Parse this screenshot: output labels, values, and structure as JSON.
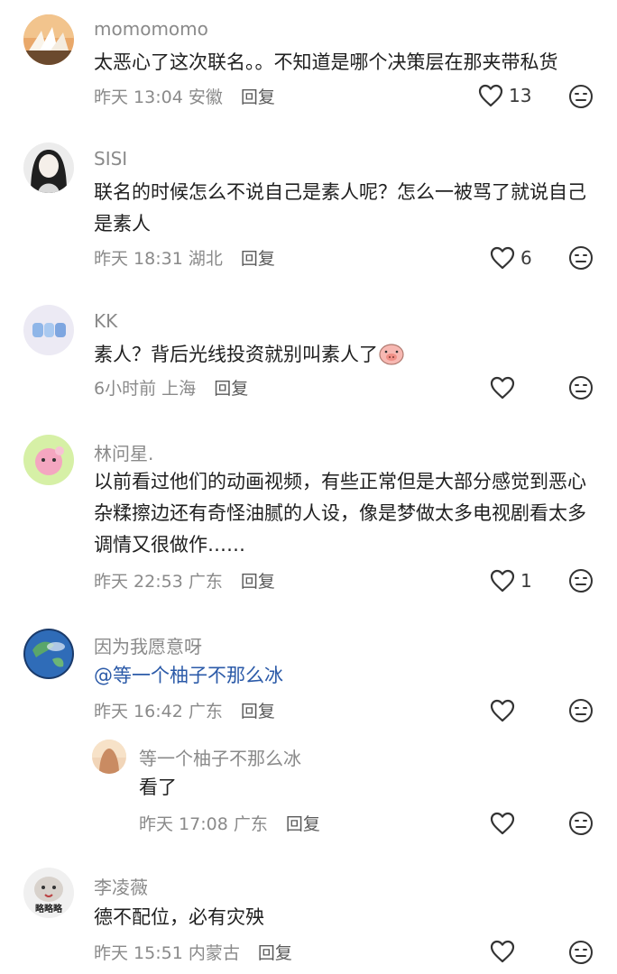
{
  "comments": [
    {
      "user": "momomomo",
      "text": "太恶心了这次联名。。不知道是哪个决策层在那夹带私货",
      "time": "昨天 13:04",
      "location": "安徽",
      "reply": "回复",
      "likes": "13"
    },
    {
      "user": "SISI",
      "text": "联名的时候怎么不说自己是素人呢？怎么一被骂了就说自己是素人",
      "time": "昨天 18:31",
      "location": "湖北",
      "reply": "回复",
      "likes": "6"
    },
    {
      "user": "KK",
      "text": "素人？背后光线投资就别叫素人了",
      "time": "6小时前",
      "location": "上海",
      "reply": "回复",
      "likes": ""
    },
    {
      "user": "林问星.",
      "text": "以前看过他们的动画视频，有些正常但是大部分感觉到恶心杂糅擦边还有奇怪油腻的人设，像是梦做太多电视剧看太多调情又很做作……",
      "time": "昨天 22:53",
      "location": "广东",
      "reply": "回复",
      "likes": "1"
    },
    {
      "user": "因为我愿意呀",
      "text": "@等一个柚子不那么冰",
      "time": "昨天 16:42",
      "location": "广东",
      "reply": "回复",
      "likes": ""
    },
    {
      "user": "等一个柚子不那么冰",
      "text": "看了",
      "time": "昨天 17:08",
      "location": "广东",
      "reply": "回复",
      "likes": ""
    },
    {
      "user": "李凌薇",
      "text": "德不配位，必有灾殃",
      "time": "昨天 15:51",
      "location": "内蒙古",
      "reply": "回复",
      "likes": "",
      "avatar_caption": "略略略"
    }
  ],
  "colors": {
    "accent_mention": "#2b5aa8",
    "muted": "#8a8a8a"
  }
}
